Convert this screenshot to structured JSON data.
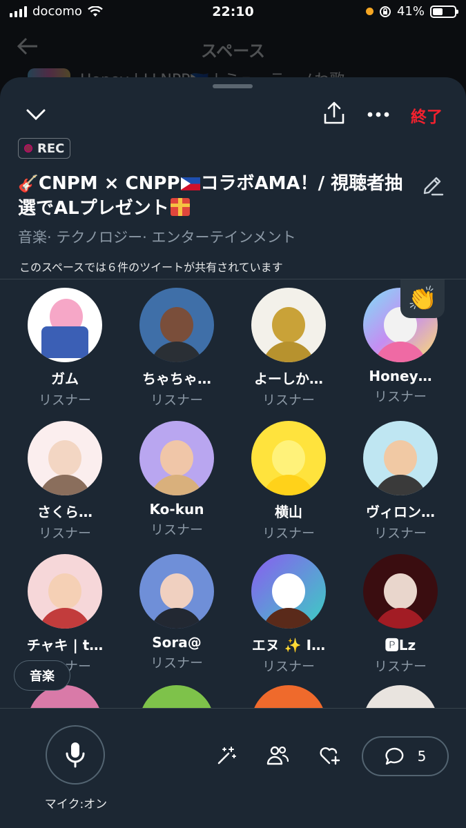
{
  "status_bar": {
    "carrier": "docomo",
    "time": "22:10",
    "battery": "41%"
  },
  "background_page": {
    "title": "スペース",
    "preview_text": "Honey | LLNPP🇵🇭 | ミューテ · ノわ歌"
  },
  "space": {
    "end_label": "終了",
    "rec_label": "REC",
    "title": "CNPM × CNPP",
    "title_part2": "コラボAMA！/ 視聴者抽選でALプレゼント",
    "categories": "音楽· テクノロジー· エンターテインメント",
    "shared_info": "このスペースでは６件のツイートが共有されています"
  },
  "participants": [
    {
      "name": "ガム",
      "role": "リスナー"
    },
    {
      "name": "ちゃちゃ…",
      "role": "リスナー"
    },
    {
      "name": "よーしか…",
      "role": "リスナー"
    },
    {
      "name": "Honey…",
      "role": "リスナー"
    },
    {
      "name": "さくら…",
      "role": "リスナー"
    },
    {
      "name": "Ko-kun",
      "role": "リスナー"
    },
    {
      "name": "横山",
      "role": "リスナー"
    },
    {
      "name": "ヴィロン…",
      "role": "リスナー"
    },
    {
      "name": "チャキ | t…",
      "role": "リスナー"
    },
    {
      "name": "Sora@",
      "role": "リスナー"
    },
    {
      "name": "エヌ ✨ I…",
      "role": "リスナー"
    },
    {
      "name": "🅿Lz",
      "role": "リスナー"
    }
  ],
  "topic_chip": "音楽",
  "bottom": {
    "mic_label": "マイク:オン",
    "reply_count": "5"
  },
  "colors": {
    "sheet_bg": "#1c2733",
    "end_red": "#f4212e",
    "muted_text": "#8b98a5",
    "divider": "#38444d"
  },
  "icons": [
    "chevron-down-icon",
    "share-icon",
    "more-icon",
    "edit-icon",
    "mic-icon",
    "magic-wand-icon",
    "people-icon",
    "heart-plus-icon",
    "reply-icon",
    "clap-icon"
  ]
}
